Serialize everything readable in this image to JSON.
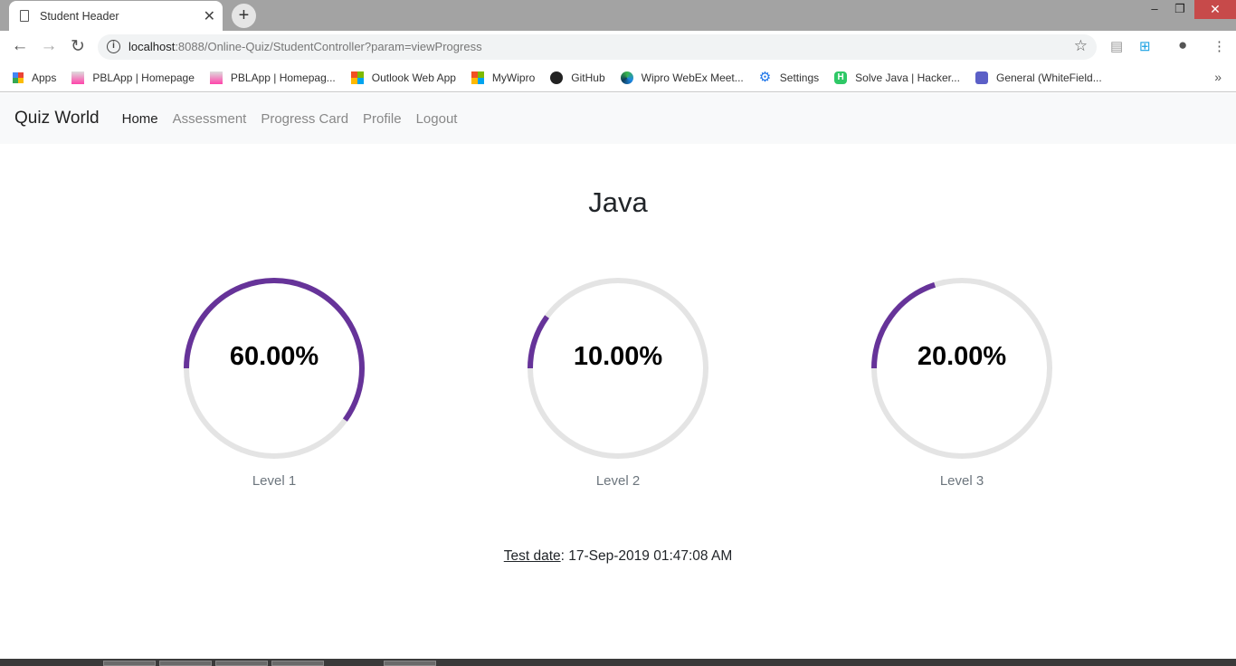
{
  "browser": {
    "tab_title": "Student Header",
    "url_host": "localhost",
    "url_rest": ":8088/Online-Quiz/StudentController?param=viewProgress",
    "bookmarks": [
      {
        "label": "Apps",
        "icon": "apps-grid-icon"
      },
      {
        "label": "PBLApp | Homepage",
        "icon": "pbl-icon"
      },
      {
        "label": "PBLApp | Homepag...",
        "icon": "pbl-icon"
      },
      {
        "label": "Outlook Web App",
        "icon": "microsoft-icon"
      },
      {
        "label": "MyWipro",
        "icon": "microsoft-icon"
      },
      {
        "label": "GitHub",
        "icon": "github-icon"
      },
      {
        "label": "Wipro WebEx Meet...",
        "icon": "webex-icon"
      },
      {
        "label": "Settings",
        "icon": "gear-icon"
      },
      {
        "label": "Solve Java | Hacker...",
        "icon": "hackerrank-icon"
      },
      {
        "label": "General (WhiteField...",
        "icon": "teams-icon"
      }
    ]
  },
  "navbar": {
    "brand": "Quiz World",
    "links": [
      {
        "label": "Home",
        "active": true
      },
      {
        "label": "Assessment",
        "active": false
      },
      {
        "label": "Progress Card",
        "active": false
      },
      {
        "label": "Profile",
        "active": false
      },
      {
        "label": "Logout",
        "active": false
      }
    ]
  },
  "main": {
    "subject": "Java",
    "progress_color": "#663399",
    "track_color": "#e4e4e4",
    "levels": [
      {
        "label": "Level 1",
        "percent_text": "60.00%",
        "percent": 60
      },
      {
        "label": "Level 2",
        "percent_text": "10.00%",
        "percent": 10
      },
      {
        "label": "Level 3",
        "percent_text": "20.00%",
        "percent": 20
      }
    ],
    "test_date_label": "Test date",
    "test_date_value": ": 17-Sep-2019 01:47:08 AM"
  }
}
